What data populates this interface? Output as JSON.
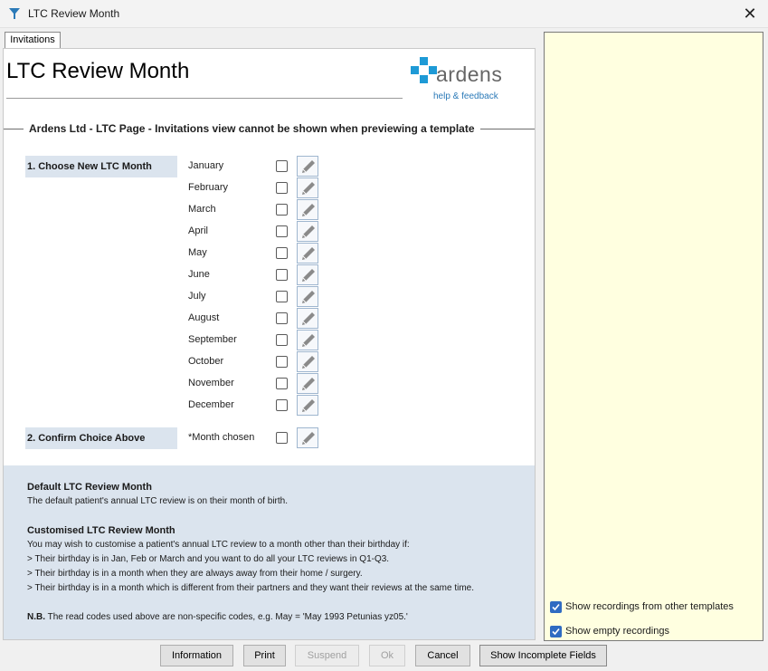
{
  "window": {
    "title": "LTC Review Month",
    "close_glyph": "✕"
  },
  "tab": {
    "label": "Invitations"
  },
  "page": {
    "title": "LTC Review Month",
    "logo_text": "ardens",
    "logo_subtext": "help & feedback",
    "section_title": "Ardens Ltd - LTC Page - Invitations view cannot be shown when previewing a template"
  },
  "steps": {
    "choose": "1. Choose New LTC Month",
    "confirm": "2. Confirm Choice Above"
  },
  "months": [
    {
      "label": "January"
    },
    {
      "label": "February"
    },
    {
      "label": "March"
    },
    {
      "label": "April"
    },
    {
      "label": "May"
    },
    {
      "label": "June"
    },
    {
      "label": "July"
    },
    {
      "label": "August"
    },
    {
      "label": "September"
    },
    {
      "label": "October"
    },
    {
      "label": "November"
    },
    {
      "label": "December"
    }
  ],
  "confirm_item": {
    "label": "*Month chosen"
  },
  "info": {
    "default_heading": "Default LTC Review Month",
    "default_text": "The default patient's annual LTC review is on their month of birth.",
    "custom_heading": "Customised LTC Review Month",
    "custom_intro": "You may wish to customise a patient's annual LTC review to a month other than their birthday if:",
    "custom_points": [
      "> Their birthday is in Jan, Feb or March and you want to do all your LTC reviews in Q1-Q3.",
      "> Their birthday is in a month when they are always away from their home / surgery.",
      "> Their birthday is in a month which is different from their partners and they want their reviews at the same time."
    ],
    "nb_label": "N.B.",
    "nb_text": " The read codes used above are non-specific codes, e.g. May = 'May 1993 Petunias yz05.'"
  },
  "right_panel": {
    "show_other_templates": "Show recordings from other templates",
    "show_empty": "Show empty recordings"
  },
  "buttons": {
    "information": "Information",
    "print": "Print",
    "suspend": "Suspend",
    "ok": "Ok",
    "cancel": "Cancel",
    "show_incomplete": "Show Incomplete Fields"
  },
  "colors": {
    "accent": "#2f6bc2",
    "logo_cross": "#1e9ad6",
    "right_panel_bg": "#ffffe0",
    "info_bg": "#dbe4ee"
  }
}
